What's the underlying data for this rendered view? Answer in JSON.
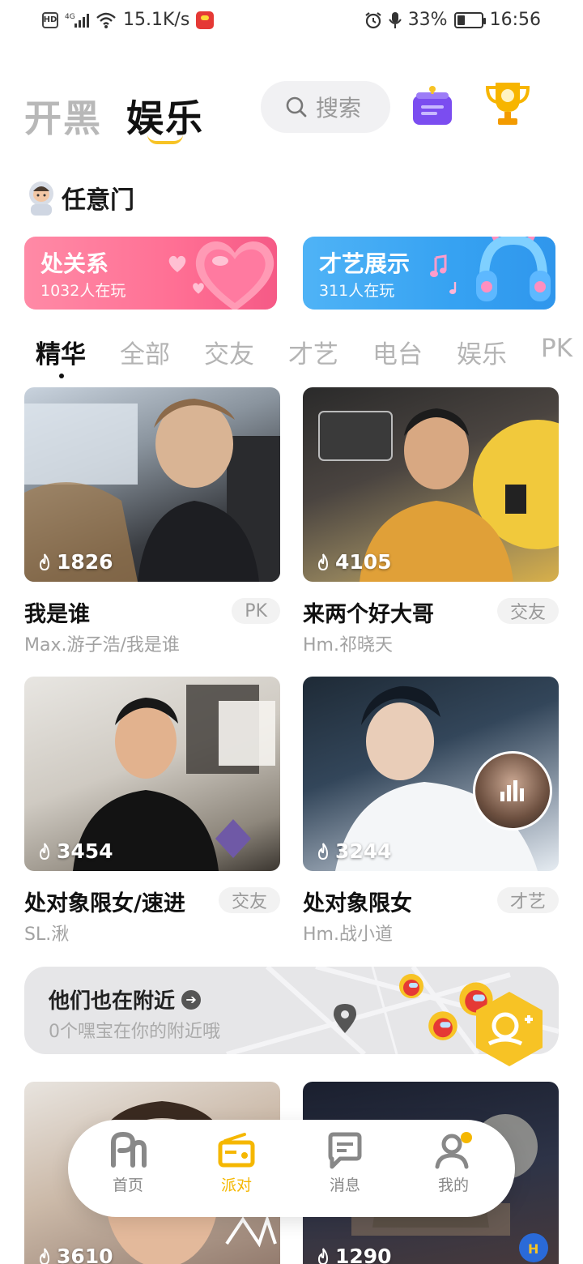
{
  "status_bar": {
    "hd": "HD",
    "network": "4G",
    "speed": "15.1K/s",
    "battery": "33%",
    "battery_level": 0.33,
    "time": "16:56"
  },
  "header": {
    "tab_kaihei": "开黑",
    "tab_yule": "娱乐",
    "search_placeholder": "搜索"
  },
  "portal": {
    "title": "任意门",
    "cards": [
      {
        "title": "处关系",
        "subtitle": "1032人在玩"
      },
      {
        "title": "才艺展示",
        "subtitle": "311人在玩"
      }
    ]
  },
  "category_tabs": [
    "精华",
    "全部",
    "交友",
    "才艺",
    "电台",
    "娱乐",
    "PK"
  ],
  "rooms": [
    {
      "heat": "1826",
      "title": "我是谁",
      "tag": "PK",
      "owner": "Max.游子浩/我是谁"
    },
    {
      "heat": "4105",
      "title": "来两个好大哥",
      "tag": "交友",
      "owner": "Hm.祁晓天"
    },
    {
      "heat": "3454",
      "title": "处对象限女/速进",
      "tag": "交友",
      "owner": "SL.湫"
    },
    {
      "heat": "3244",
      "title": "处对象限女",
      "tag": "才艺",
      "owner": "Hm.战小道"
    },
    {
      "heat": "3610"
    },
    {
      "heat": "1290"
    }
  ],
  "nearby": {
    "title": "他们也在附近",
    "subtitle": "0个嘿宝在你的附近哦"
  },
  "bottom_nav": [
    {
      "label": "首页",
      "icon": "home-icon"
    },
    {
      "label": "派对",
      "icon": "party-radio-icon"
    },
    {
      "label": "消息",
      "icon": "message-icon"
    },
    {
      "label": "我的",
      "icon": "profile-icon"
    }
  ],
  "colors": {
    "accent": "#f5b700",
    "love_card": "#ff6f94",
    "talent_card": "#36a2f2"
  }
}
